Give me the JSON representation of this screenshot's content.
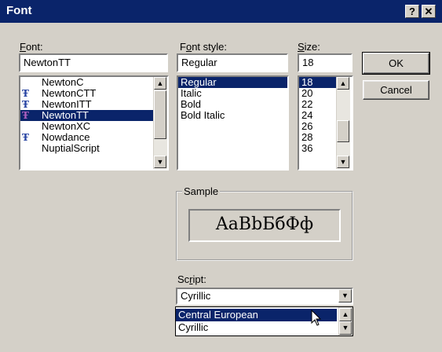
{
  "window": {
    "title": "Font",
    "help_label": "?",
    "close_label": "✕"
  },
  "font": {
    "label_u": "F",
    "label_rest": "ont:",
    "value": "NewtonTT",
    "items": [
      {
        "label": "NewtonC",
        "truetype": false,
        "selected": false
      },
      {
        "label": "NewtonCTT",
        "truetype": true,
        "selected": false
      },
      {
        "label": "NewtonITT",
        "truetype": true,
        "selected": false
      },
      {
        "label": "NewtonTT",
        "truetype": true,
        "selected": true
      },
      {
        "label": "NewtonXC",
        "truetype": false,
        "selected": false
      },
      {
        "label": "Nowdance",
        "truetype": true,
        "selected": false
      },
      {
        "label": "NuptialScript",
        "truetype": false,
        "selected": false
      }
    ]
  },
  "style": {
    "label_pre": "F",
    "label_u": "o",
    "label_rest": "nt style:",
    "value": "Regular",
    "items": [
      {
        "label": "Regular",
        "selected": true
      },
      {
        "label": "Italic",
        "selected": false
      },
      {
        "label": "Bold",
        "selected": false
      },
      {
        "label": "Bold Italic",
        "selected": false
      }
    ]
  },
  "size": {
    "label_u": "S",
    "label_rest": "ize:",
    "value": "18",
    "items": [
      {
        "label": "18",
        "selected": true
      },
      {
        "label": "20",
        "selected": false
      },
      {
        "label": "22",
        "selected": false
      },
      {
        "label": "24",
        "selected": false
      },
      {
        "label": "26",
        "selected": false
      },
      {
        "label": "28",
        "selected": false
      },
      {
        "label": "36",
        "selected": false
      }
    ]
  },
  "buttons": {
    "ok": "OK",
    "cancel": "Cancel"
  },
  "sample": {
    "legend": "Sample",
    "text": "AaBbБбФф"
  },
  "script": {
    "label_pre": "Sc",
    "label_u": "r",
    "label_rest": "ipt:",
    "value": "Cyrillic",
    "options": [
      {
        "label": "Central European",
        "selected": true
      },
      {
        "label": "Cyrillic",
        "selected": false
      }
    ]
  },
  "icons": {
    "truetype": "truetype-icon",
    "scroll_up": "▲",
    "scroll_down": "▼",
    "tt_glyph": "Ŧ"
  }
}
